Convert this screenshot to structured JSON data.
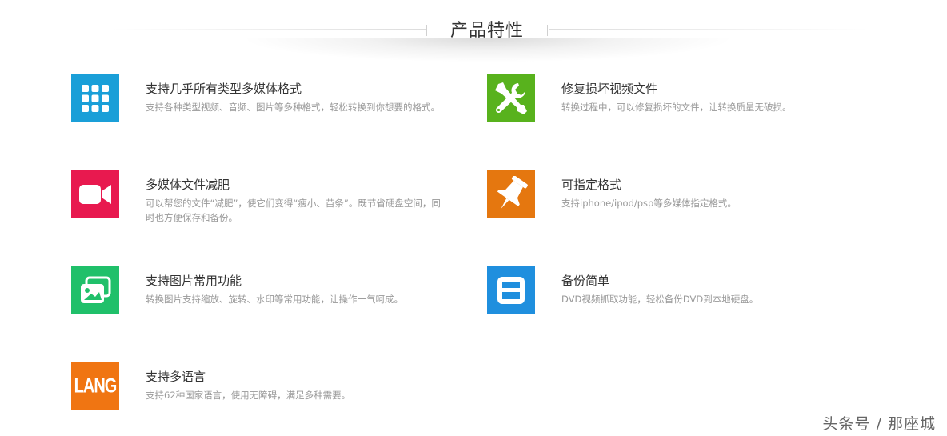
{
  "section": {
    "title": "产品特性"
  },
  "features": [
    {
      "title": "支持几乎所有类型多媒体格式",
      "desc": "支持各种类型视频、音频、图片等多种格式，轻松转换到你想要的格式。",
      "icon": "grid-apps-icon",
      "color": "#1a9fd8"
    },
    {
      "title": "修复损坏视频文件",
      "desc": "转换过程中，可以修复损坏的文件，让转换质量无破损。",
      "icon": "repair-tools-icon",
      "color": "#58b21d"
    },
    {
      "title": "多媒体文件减肥",
      "desc": "可以帮您的文件“减肥”，使它们变得“瘦小、苗条”。既节省硬盘空间，同时也方便保存和备份。",
      "icon": "video-camera-icon",
      "color": "#e8194f"
    },
    {
      "title": "可指定格式",
      "desc": "支持iphone/ipod/psp等多媒体指定格式。",
      "icon": "pushpin-icon",
      "color": "#e5770f"
    },
    {
      "title": "支持图片常用功能",
      "desc": "转换图片支持缩放、旋转、水印等常用功能，让操作一气呵成。",
      "icon": "pictures-icon",
      "color": "#20c06a"
    },
    {
      "title": "备份简单",
      "desc": "DVD视频抓取功能，轻松备份DVD到本地硬盘。",
      "icon": "floppy-disk-icon",
      "color": "#1f8fde"
    },
    {
      "title": "支持多语言",
      "desc": "支持62种国家语言，使用无障碍，满足多种需要。",
      "icon": "lang-icon",
      "icon_text": "LANG",
      "color": "#f07512"
    }
  ],
  "watermark": "头条号 / 那座城"
}
